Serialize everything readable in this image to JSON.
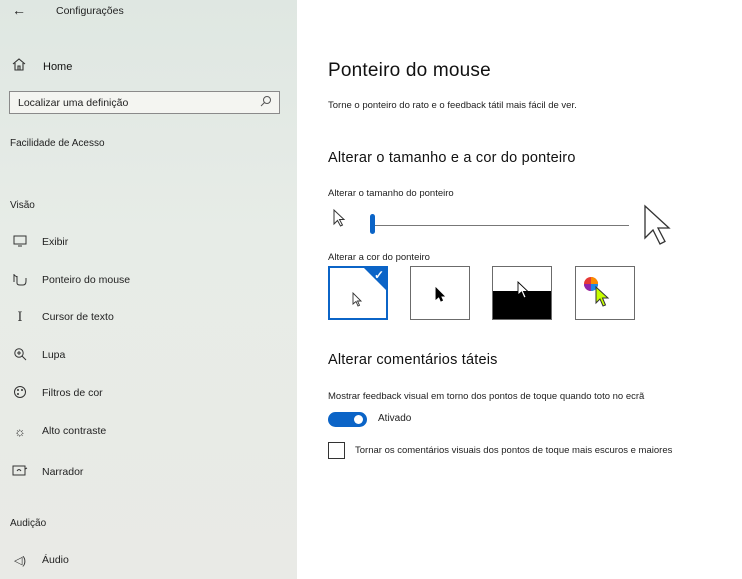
{
  "window": {
    "title": "Configurações"
  },
  "sidebar": {
    "home_label": "Home",
    "search_placeholder": "Localizar uma definição",
    "category": "Facilidade de Acesso",
    "groups": [
      {
        "label": "Visão",
        "items": [
          {
            "label": "Exibir",
            "icon": "monitor-icon"
          },
          {
            "label": "Ponteiro do mouse",
            "icon": "pointer-icon"
          },
          {
            "label": "Cursor de texto",
            "icon": "text-cursor-icon"
          },
          {
            "label": "Lupa",
            "icon": "magnifier-icon"
          },
          {
            "label": "Filtros de cor",
            "icon": "color-filter-icon"
          },
          {
            "label": "Alto contraste",
            "icon": "high-contrast-icon"
          },
          {
            "label": "Narrador",
            "icon": "narrator-icon"
          }
        ]
      },
      {
        "label": "Audição",
        "items": [
          {
            "label": "Áudio",
            "icon": "speaker-icon"
          }
        ]
      }
    ]
  },
  "main": {
    "title": "Ponteiro do mouse",
    "description": "Torne o ponteiro do rato e o feedback tátil mais fácil de ver.",
    "size_color_section": {
      "heading": "Alterar o tamanho e a cor do ponteiro",
      "size_label": "Alterar o tamanho do ponteiro",
      "size_value": 0.0,
      "color_label": "Alterar a cor do ponteiro",
      "color_options": [
        {
          "name": "white",
          "selected": true
        },
        {
          "name": "black",
          "selected": false
        },
        {
          "name": "inverted",
          "selected": false
        },
        {
          "name": "custom",
          "selected": false
        }
      ]
    },
    "touch_section": {
      "heading": "Alterar comentários táteis",
      "feedback_label": "Mostrar feedback visual em torno dos pontos de toque quando toto no ecrã",
      "toggle_state": "Ativado",
      "toggle_on": true,
      "checkbox_label": "Tornar os comentários visuais dos pontos de toque mais escuros e maiores",
      "checkbox_checked": false
    }
  },
  "colors": {
    "accent": "#0b64c7"
  }
}
